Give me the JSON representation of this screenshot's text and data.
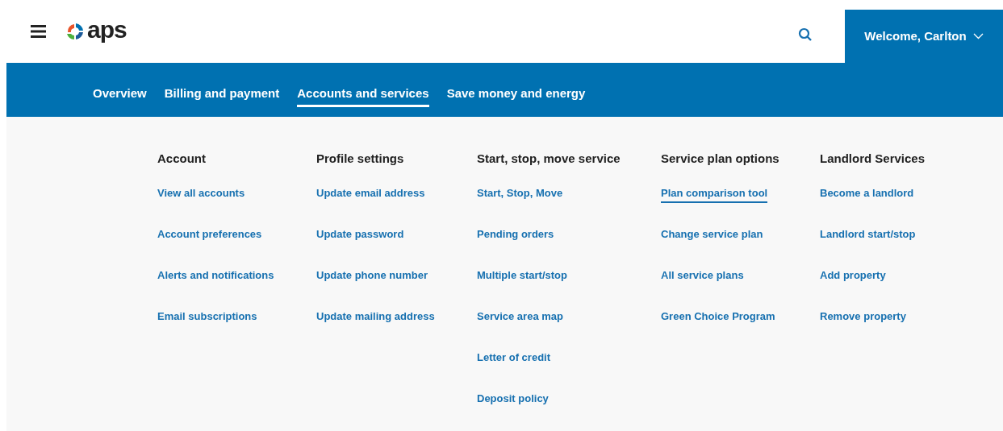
{
  "header": {
    "logo_text": "aps",
    "welcome": "Welcome, Carlton"
  },
  "nav": [
    {
      "label": "Overview",
      "selected": false
    },
    {
      "label": "Billing and payment",
      "selected": false
    },
    {
      "label": "Accounts and services",
      "selected": true
    },
    {
      "label": "Save money and energy",
      "selected": false
    }
  ],
  "menu_columns": [
    {
      "heading": "Account",
      "links": [
        {
          "label": "View all accounts",
          "selected": false
        },
        {
          "label": "Account preferences",
          "selected": false
        },
        {
          "label": "Alerts and notifications",
          "selected": false
        },
        {
          "label": "Email subscriptions",
          "selected": false
        }
      ]
    },
    {
      "heading": "Profile settings",
      "links": [
        {
          "label": "Update email address",
          "selected": false
        },
        {
          "label": "Update password",
          "selected": false
        },
        {
          "label": "Update phone number",
          "selected": false
        },
        {
          "label": "Update mailing address",
          "selected": false
        }
      ]
    },
    {
      "heading": "Start, stop, move service",
      "links": [
        {
          "label": "Start, Stop, Move",
          "selected": false
        },
        {
          "label": "Pending orders",
          "selected": false
        },
        {
          "label": "Multiple start/stop",
          "selected": false
        },
        {
          "label": "Service area map",
          "selected": false
        },
        {
          "label": "Letter of credit",
          "selected": false
        },
        {
          "label": "Deposit policy",
          "selected": false
        }
      ]
    },
    {
      "heading": "Service plan options",
      "links": [
        {
          "label": "Plan comparison tool",
          "selected": true
        },
        {
          "label": "Change service plan",
          "selected": false
        },
        {
          "label": "All service plans",
          "selected": false
        },
        {
          "label": "Green Choice Program",
          "selected": false
        }
      ]
    },
    {
      "heading": "Landlord Services",
      "links": [
        {
          "label": "Become a landlord",
          "selected": false
        },
        {
          "label": "Landlord start/stop",
          "selected": false
        },
        {
          "label": "Add property",
          "selected": false
        },
        {
          "label": "Remove property",
          "selected": false
        }
      ]
    }
  ]
}
